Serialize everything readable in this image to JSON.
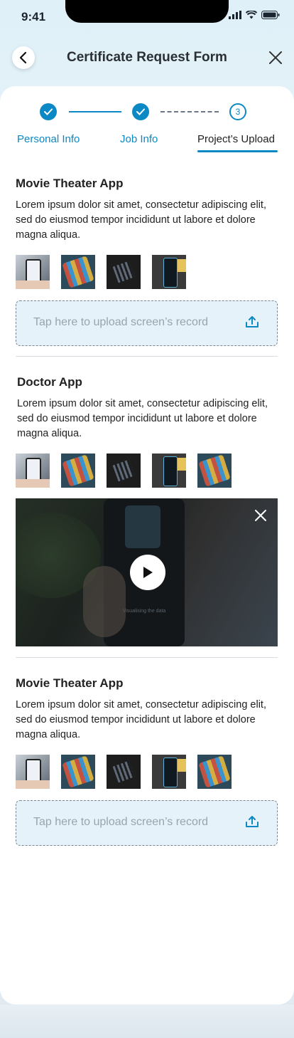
{
  "status_bar": {
    "time": "9:41"
  },
  "header": {
    "title": "Certificate Request Form",
    "back_icon": "chevron-left-icon",
    "close_icon": "close-icon"
  },
  "stepper": {
    "steps": [
      {
        "label": "Personal Info",
        "state": "done"
      },
      {
        "label": "Job Info",
        "state": "done"
      },
      {
        "label": "Project’s Upload",
        "state": "current",
        "number": "3"
      }
    ]
  },
  "sections": [
    {
      "title": "Movie Theater App",
      "description": "Lorem ipsum dolor sit amet, consectetur adipiscing elit, sed do eiusmod tempor incididunt ut labore et dolore magna aliqua.",
      "upload_label": "Tap here to upload screen’s record"
    },
    {
      "title": "Doctor App",
      "description": "Lorem ipsum dolor sit amet, consectetur adipiscing elit, sed do eiusmod tempor incididunt ut labore et dolore magna aliqua."
    },
    {
      "title": "Movie Theater App",
      "description": "Lorem ipsum dolor sit amet, consectetur adipiscing elit, sed do eiusmod tempor incididunt ut labore et dolore magna aliqua.",
      "upload_label": "Tap here to upload screen’s record"
    }
  ],
  "video": {
    "screen_text": "Visualising the data"
  },
  "colors": {
    "accent": "#0c88c4",
    "upload_bg": "#e6f2f9"
  }
}
